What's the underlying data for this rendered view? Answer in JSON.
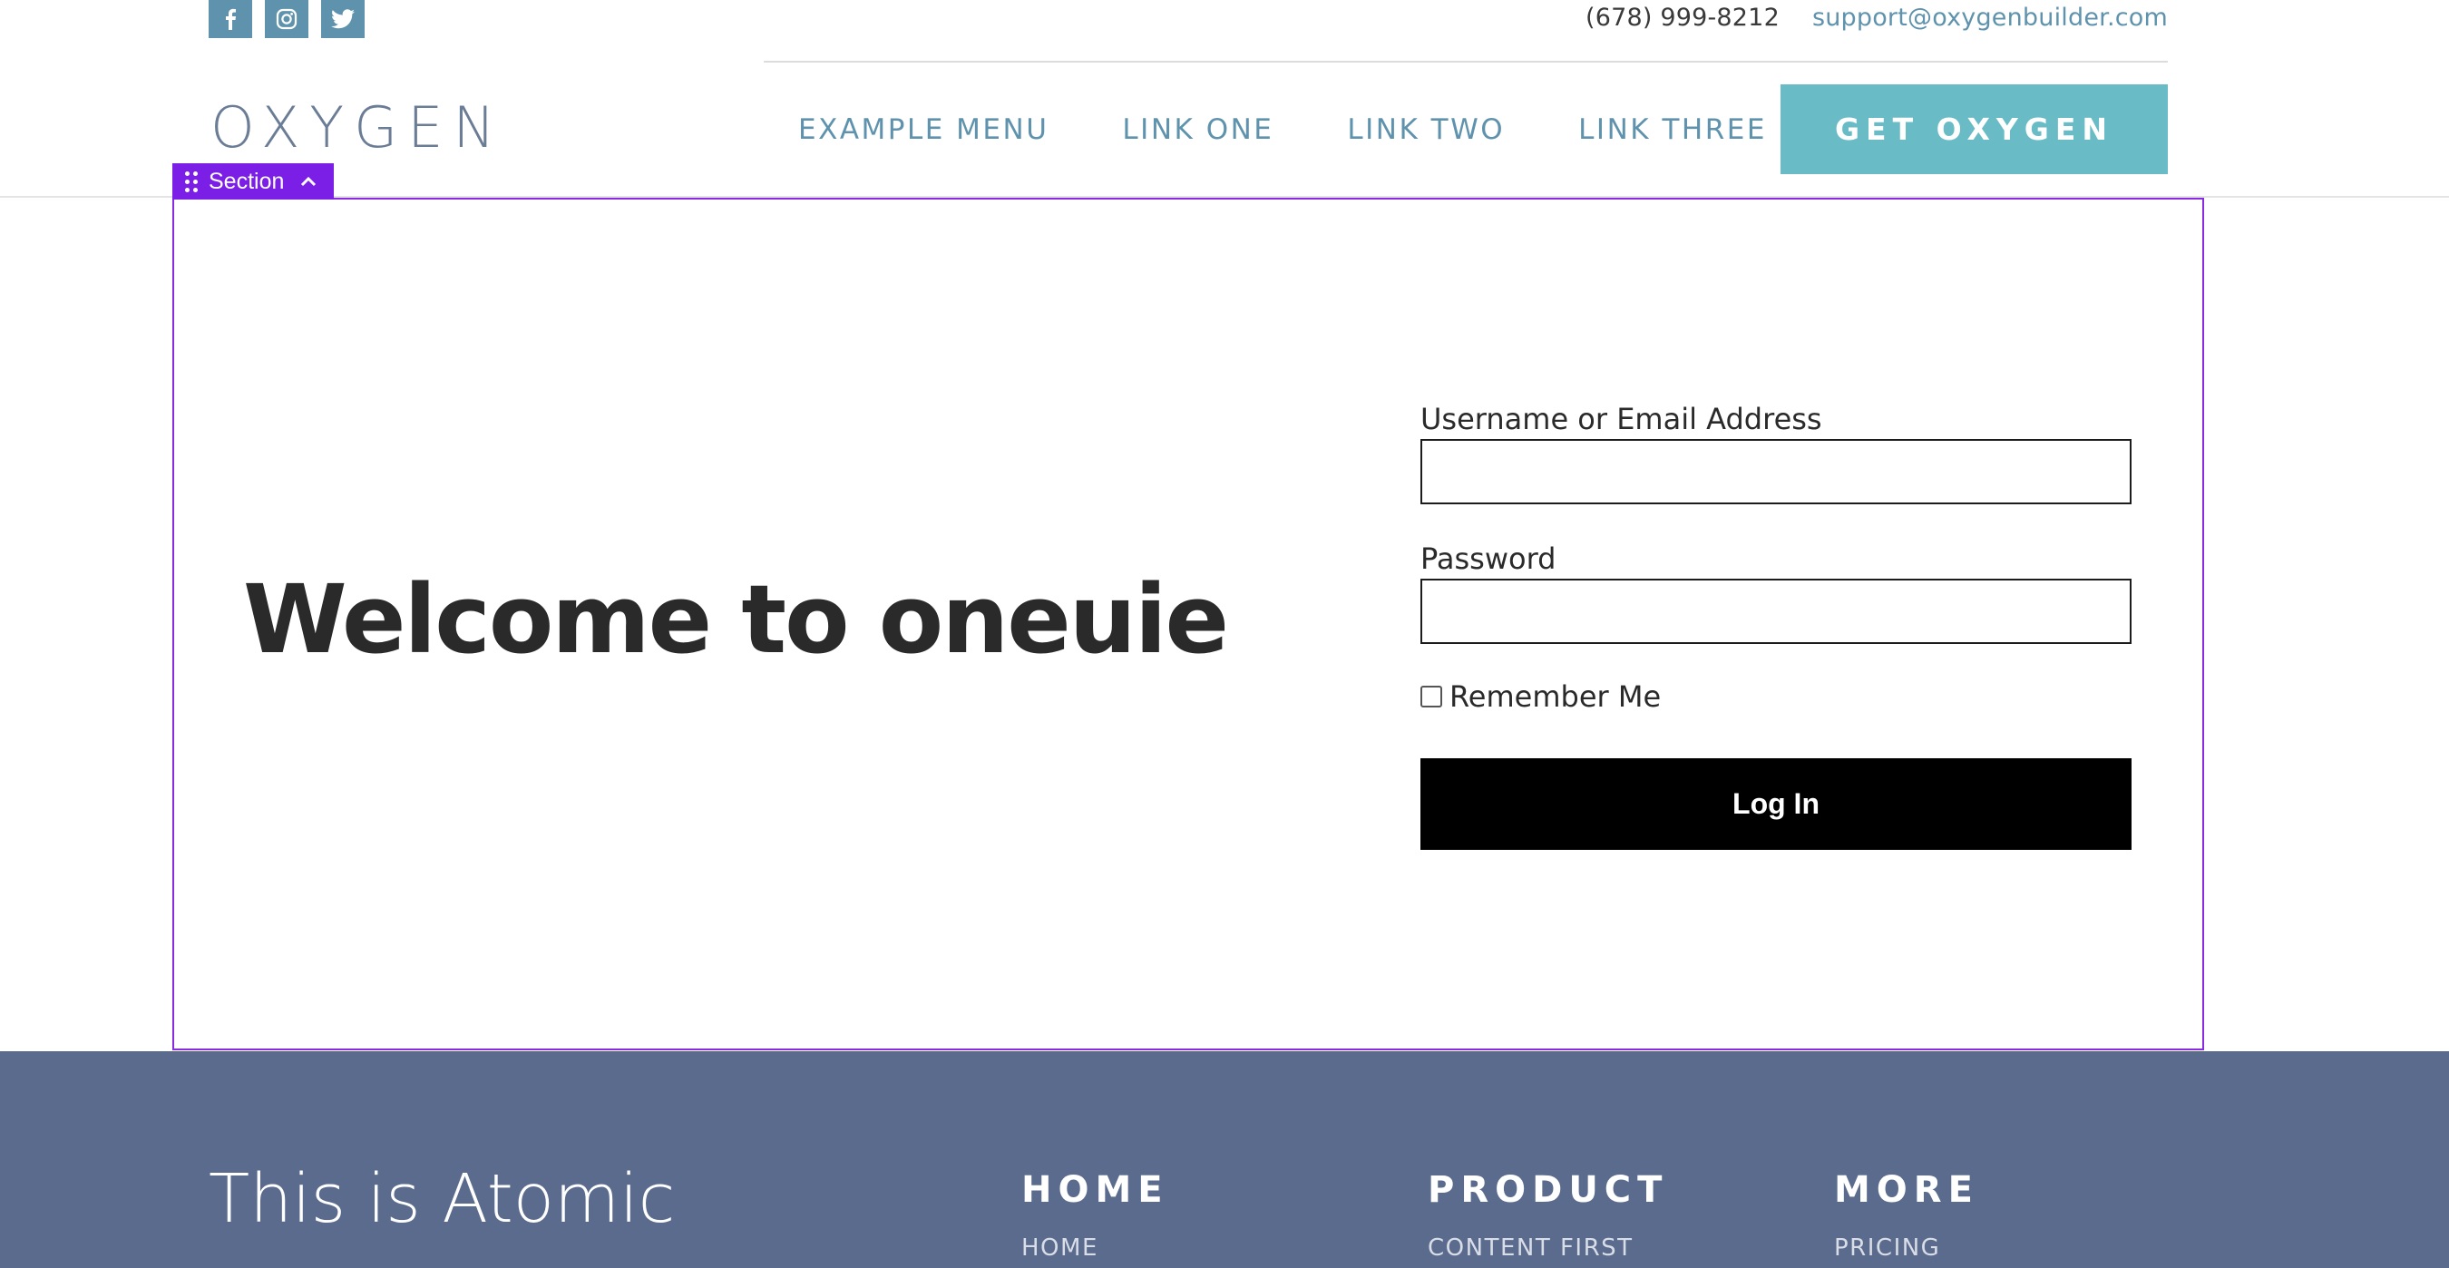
{
  "topbar": {
    "social": [
      {
        "name": "facebook-icon"
      },
      {
        "name": "instagram-icon"
      },
      {
        "name": "twitter-icon"
      }
    ],
    "phone": "(678) 999-8212",
    "email": "support@oxygenbuilder.com"
  },
  "header": {
    "logo": "OXYGEN",
    "nav": [
      {
        "label": "EXAMPLE MENU"
      },
      {
        "label": "LINK ONE"
      },
      {
        "label": "LINK TWO"
      },
      {
        "label": "LINK THREE"
      }
    ],
    "cta_label": "GET OXYGEN"
  },
  "builder": {
    "section_tab_label": "Section",
    "accent": "#7b1fe6"
  },
  "hero": {
    "heading": "Welcome to oneuie"
  },
  "login": {
    "username_label": "Username or Email Address",
    "username_value": "",
    "password_label": "Password",
    "password_value": "",
    "remember_label": "Remember Me",
    "remember_checked": false,
    "submit_label": "Log In"
  },
  "footer": {
    "brand": "This is Atomic",
    "columns": [
      {
        "heading": "HOME",
        "first_link": "HOME"
      },
      {
        "heading": "PRODUCT",
        "first_link": "CONTENT FIRST"
      },
      {
        "heading": "MORE",
        "first_link": "PRICING"
      }
    ],
    "background": "#5b6b8d"
  },
  "colors": {
    "link_blue": "#5f93ad",
    "cta_teal": "#69bcc6",
    "text_dark": "#2a2a2a"
  }
}
